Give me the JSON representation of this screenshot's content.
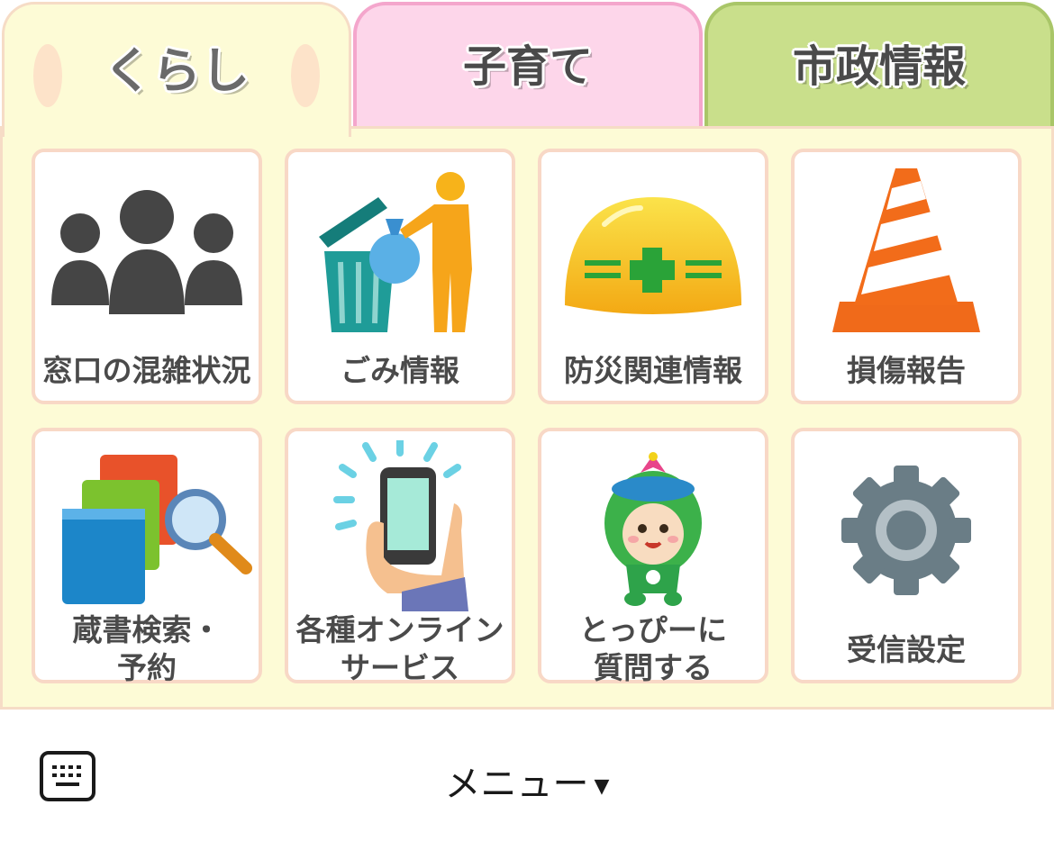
{
  "tabs": [
    {
      "label": "くらし",
      "active": true,
      "color": "#fdfbd6"
    },
    {
      "label": "子育て",
      "active": false,
      "color": "#fdd6ea"
    },
    {
      "label": "市政情報",
      "active": false,
      "color": "#c9df8b"
    }
  ],
  "menu_items": [
    {
      "label": "窓口の混雑状況",
      "icon": "people-icon"
    },
    {
      "label": "ごみ情報",
      "icon": "garbage-icon"
    },
    {
      "label": "防災関連情報",
      "icon": "helmet-icon"
    },
    {
      "label": "損傷報告",
      "icon": "traffic-cone-icon"
    },
    {
      "label": "蔵書検索・\n予約",
      "icon": "books-search-icon"
    },
    {
      "label": "各種オンライン\nサービス",
      "icon": "smartphone-icon"
    },
    {
      "label": "とっぴーに\n質問する",
      "icon": "mascot-icon"
    },
    {
      "label": "受信設定",
      "icon": "gear-icon"
    }
  ],
  "bottom_bar": {
    "menu_label": "メニュー",
    "menu_arrow": "▼",
    "keyboard_icon": "keyboard-icon"
  }
}
